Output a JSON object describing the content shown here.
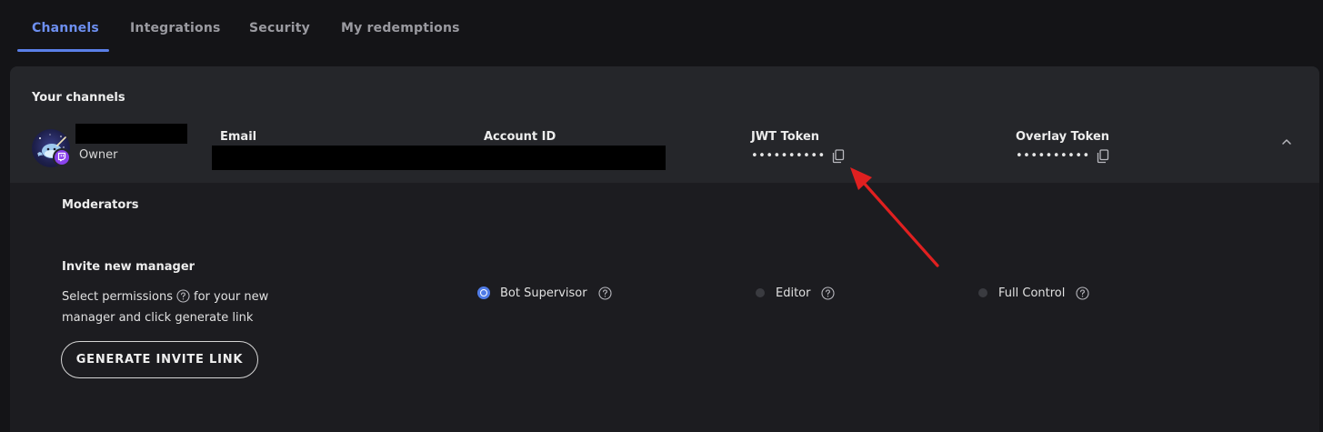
{
  "tabs": [
    {
      "label": "Channels",
      "active": true
    },
    {
      "label": "Integrations",
      "active": false
    },
    {
      "label": "Security",
      "active": false
    },
    {
      "label": "My redemptions",
      "active": false
    }
  ],
  "channels": {
    "title": "Your channels",
    "row": {
      "role": "Owner",
      "columns": {
        "email": {
          "label": "Email"
        },
        "account_id": {
          "label": "Account ID"
        },
        "jwt_token": {
          "label": "JWT Token",
          "masked_value": "••••••••••"
        },
        "overlay_token": {
          "label": "Overlay Token",
          "masked_value": "••••••••••"
        }
      }
    }
  },
  "moderators": {
    "title": "Moderators"
  },
  "invite": {
    "title": "Invite new manager",
    "description_part1": "Select permissions",
    "description_part2": "for your new manager and click generate link",
    "button_label": "GENERATE INVITE LINK",
    "options": [
      {
        "label": "Bot Supervisor",
        "checked": true
      },
      {
        "label": "Editor",
        "checked": false
      },
      {
        "label": "Full Control",
        "checked": false
      }
    ]
  },
  "colors": {
    "accent": "#5a7fe8",
    "background": "#141417",
    "card": "#1c1c20",
    "card_header": "#25262a",
    "twitch": "#8a43ec",
    "annotation": "#e02020"
  },
  "icons": {
    "copy": "copy-icon",
    "help": "help-circle-icon",
    "collapse": "chevron-up-icon",
    "platform": "twitch-icon"
  }
}
